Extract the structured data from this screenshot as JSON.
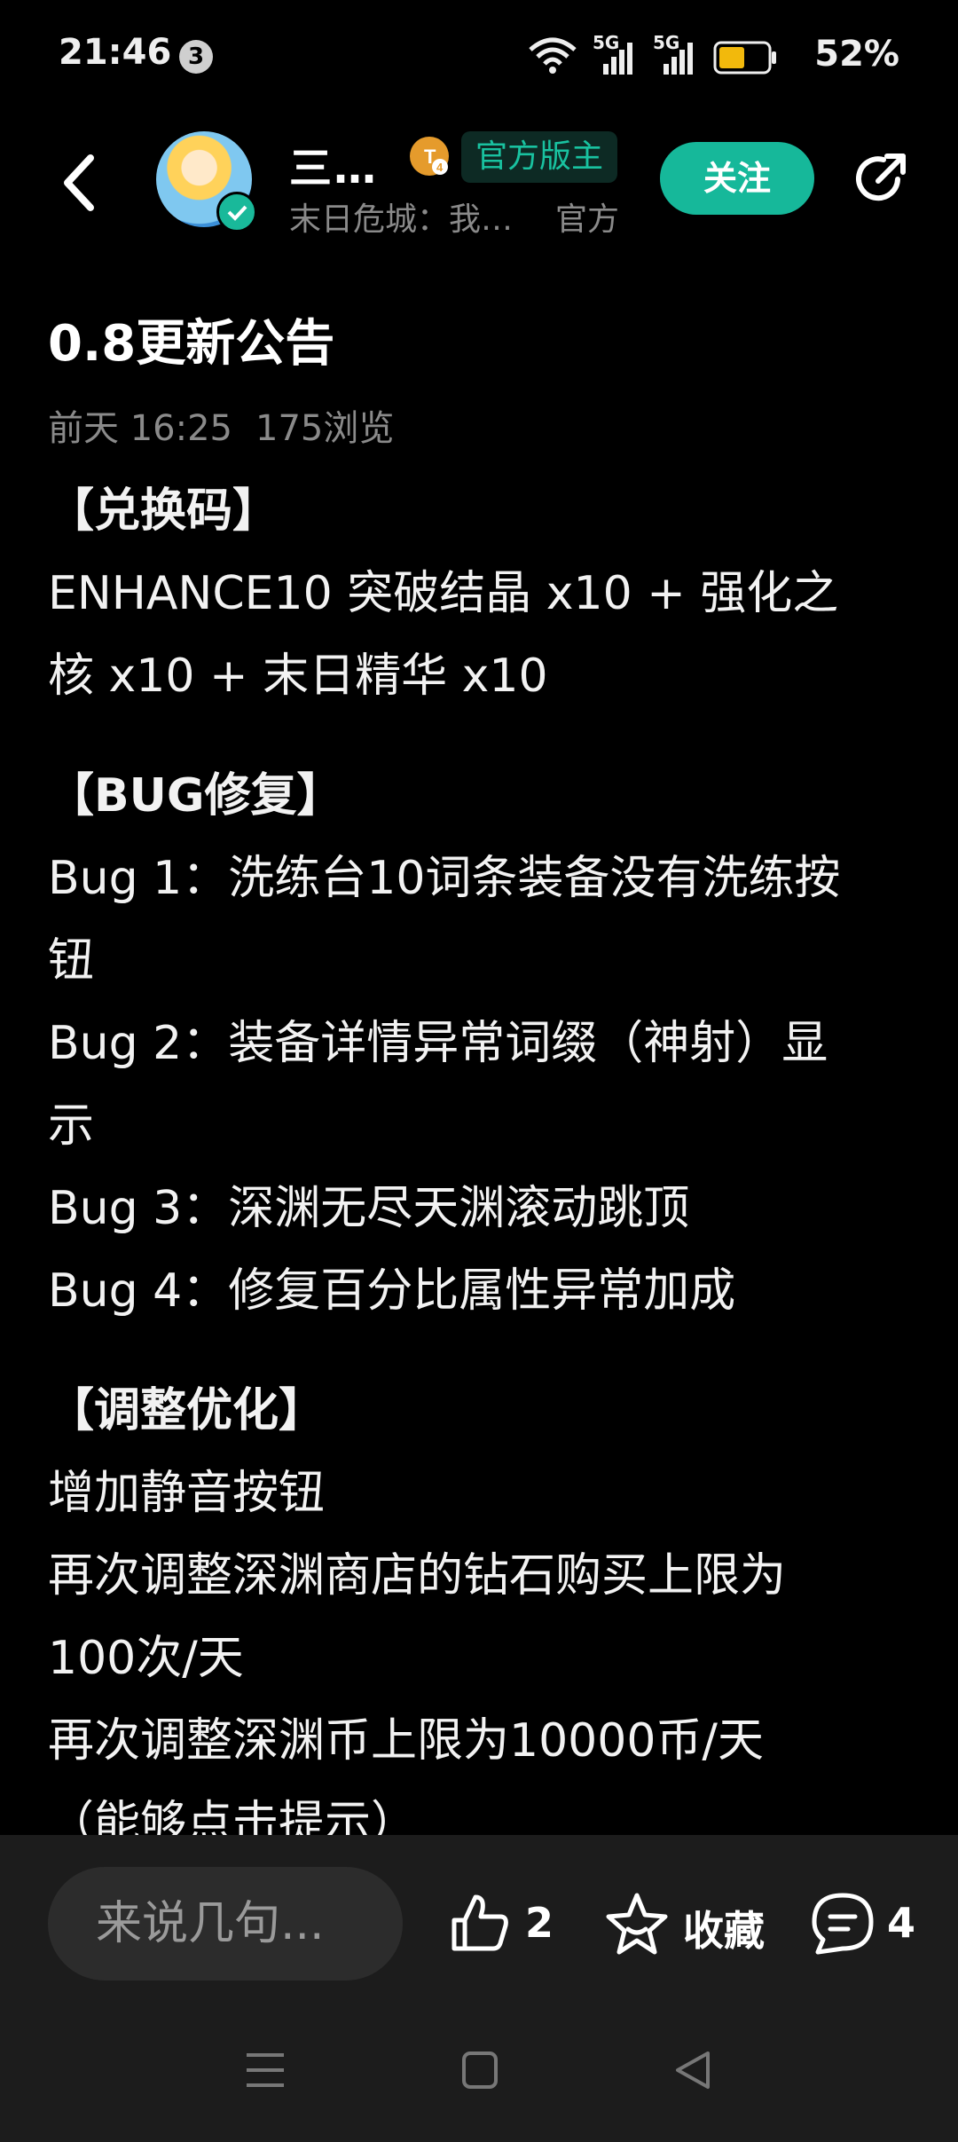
{
  "status_bar": {
    "time": "21:46",
    "notification_count": "3",
    "network_1": "5G",
    "network_2": "5G",
    "battery_percent": "52%"
  },
  "header": {
    "author_name": "三…",
    "role_badge": "官方版主",
    "author_sub": "末日危城：我…",
    "author_tag": "官方",
    "follow_label": "关注",
    "level_icon": "t4-level-icon",
    "accent_color": "#16b89a"
  },
  "post": {
    "title": "0.8更新公告",
    "date": "前天 16:25",
    "views": "175浏览",
    "sections": [
      {
        "heading": "【兑换码】",
        "lines": [
          "ENHANCE10 突破结晶 x10 + 强化之",
          "核 x10 + 末日精华 x10"
        ]
      },
      {
        "heading": "【BUG修复】",
        "lines": [
          "Bug 1：洗练台10词条装备没有洗练按",
          "钮",
          "Bug 2：装备详情异常词缀（神射）显",
          "示",
          "Bug 3：深渊无尽天渊滚动跳顶",
          "Bug 4：修复百分比属性异常加成"
        ]
      },
      {
        "heading": "【调整优化】",
        "lines": [
          "增加静音按钮",
          "再次调整深渊商店的钻石购买上限为",
          "100次/天",
          "再次调整深渊币上限为10000币/天",
          "（能够点击提示）"
        ]
      }
    ]
  },
  "bottom_bar": {
    "comment_placeholder": "来说几句...",
    "like_count": "2",
    "favorite_label": "收藏",
    "comment_count": "4"
  }
}
